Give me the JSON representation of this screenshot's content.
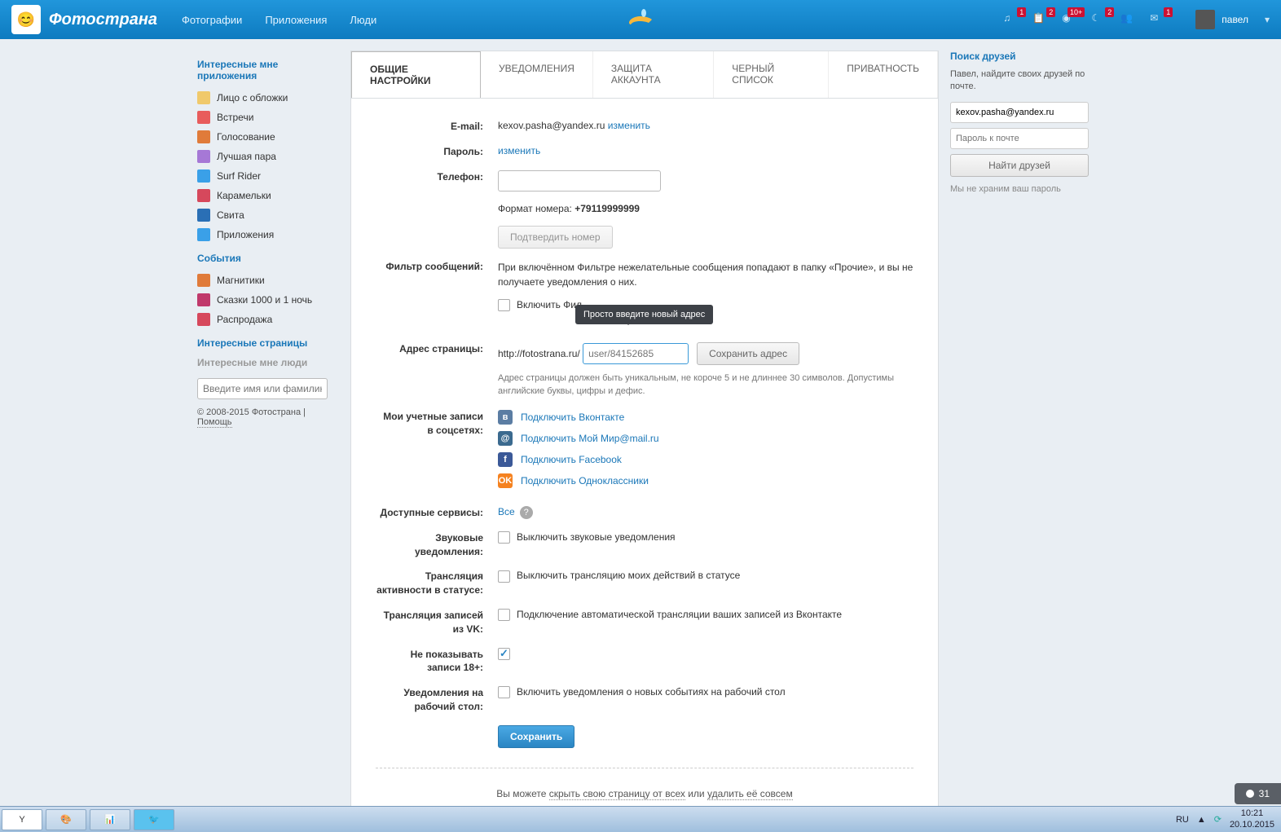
{
  "header": {
    "brand": "Фотострана",
    "nav": {
      "photos": "Фотографии",
      "apps": "Приложения",
      "people": "Люди"
    },
    "icons": {
      "music": "1",
      "list": "2",
      "grid": "10+",
      "moon": "2",
      "people": "",
      "mail": "1"
    },
    "user": "павел"
  },
  "sidebar": {
    "apps_title": "Интересные мне приложения",
    "items": [
      {
        "label": "Лицо с обложки",
        "color": "#f0c96b"
      },
      {
        "label": "Встречи",
        "color": "#e85c5c"
      },
      {
        "label": "Голосование",
        "color": "#e07b3a"
      },
      {
        "label": "Лучшая пара",
        "color": "#a678d6"
      },
      {
        "label": "Surf Rider",
        "color": "#3aa0e8"
      },
      {
        "label": "Карамельки",
        "color": "#d6485c"
      },
      {
        "label": "Свита",
        "color": "#2a6fb5"
      },
      {
        "label": "Приложения",
        "color": "#3aa0e8"
      }
    ],
    "events_title": "События",
    "events": [
      {
        "label": "Магнитики",
        "color": "#e07b3a"
      },
      {
        "label": "Сказки 1000 и 1 ночь",
        "color": "#c0396b"
      },
      {
        "label": "Распродажа",
        "color": "#d6485c"
      }
    ],
    "pages_title": "Интересные страницы",
    "people_title": "Интересные мне люди",
    "search_placeholder": "Введите имя или фамилию",
    "copyright": "© 2008-2015 Фотострана |",
    "help": "Помощь"
  },
  "tabs": {
    "t1": "ОБЩИЕ НАСТРОЙКИ",
    "t2": "УВЕДОМЛЕНИЯ",
    "t3": "ЗАЩИТА АККАУНТА",
    "t4": "ЧЕРНЫЙ СПИСОК",
    "t5": "ПРИВАТНОСТЬ"
  },
  "settings": {
    "email_label": "E-mail:",
    "email_value": "kexov.pasha@yandex.ru",
    "change": "изменить",
    "password_label": "Пароль:",
    "phone_label": "Телефон:",
    "phone_format": "Формат номера:",
    "phone_example": "+79119999999",
    "confirm_number": "Подтвердить номер",
    "filter_label": "Фильтр сообщений:",
    "filter_text": "При включённом Фильтре нежелательные сообщения попадают в папку «Прочие», и вы не получаете уведомления о них.",
    "filter_checkbox": "Включить Фил",
    "tooltip": "Просто введите новый адрес",
    "addr_label": "Адрес страницы:",
    "addr_prefix": "http://fotostrana.ru/",
    "addr_placeholder": "user/84152685",
    "save_addr": "Сохранить адрес",
    "addr_hint": "Адрес страницы должен быть уникальным, не короче 5 и не длиннее 30 символов. Допустимы английские буквы, цифры и дефис.",
    "social_label": "Мои учетные записи в соцсетях:",
    "social": {
      "vk": "Подключить Вконтакте",
      "mm": "Подключить Мой Мир@mail.ru",
      "fb": "Подключить Facebook",
      "ok": "Подключить Одноклассники"
    },
    "services_label": "Доступные сервисы:",
    "services_all": "Все",
    "sound_label": "Звуковые уведомления:",
    "sound_text": "Выключить звуковые уведомления",
    "status_label": "Трансляция активности в статусе:",
    "status_text": "Выключить трансляцию моих действий в статусе",
    "vk_label": "Трансляция записей из VK:",
    "vk_text": "Подключение автоматической трансляции ваших записей из Вконтакте",
    "adult_label": "Не показывать записи 18+:",
    "desktop_label": "Уведомления на рабочий стол:",
    "desktop_text": "Включить уведомления о новых событиях на рабочий стол",
    "save": "Сохранить",
    "footer_pre": "Вы можете ",
    "footer_hide": "скрыть свою страницу от всех",
    "footer_or": " или ",
    "footer_del": "удалить её совсем"
  },
  "right": {
    "title": "Поиск друзей",
    "text": "Павел, найдите своих друзей по почте.",
    "email": "kexov.pasha@yandex.ru",
    "pwd_placeholder": "Пароль к почте",
    "btn": "Найти друзей",
    "note": "Мы не храним ваш пароль"
  },
  "taskbar": {
    "lang": "RU",
    "time": "10:21",
    "date": "20.10.2015",
    "badge": "31"
  }
}
